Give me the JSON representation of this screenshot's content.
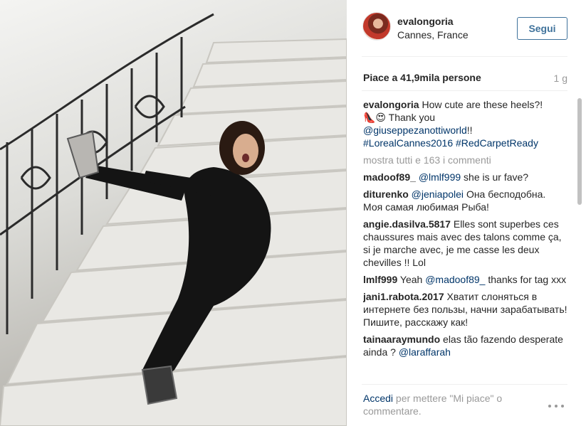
{
  "post": {
    "username": "evalongoria",
    "location": "Cannes, France",
    "follow_label": "Segui",
    "likes_text": "Piace a 41,9mila persone",
    "time_ago": "1 g",
    "caption": {
      "username": "evalongoria",
      "text_1": "How cute are these heels?!",
      "emoji": "👠😍",
      "text_2": "Thank you",
      "mention": "@giuseppezanottiworld",
      "text_3": "!!",
      "hashtags": "#LorealCannes2016 #RedCarpetReady"
    },
    "view_all_comments": "mostra tutti e 163 i commenti",
    "comments": [
      {
        "username": "madoof89_",
        "mention": "@lmlf999",
        "text": "she is ur fave?"
      },
      {
        "username": "diturenko",
        "mention": "@jeniapolei",
        "text": "Она бесподобна. Моя самая любимая Рыба!"
      },
      {
        "username": "angie.dasilva.5817",
        "mention": "",
        "text": "Elles sont superbes ces chaussures mais avec des talons comme ça, si je marche avec, je me casse les deux chevilles !! Lol"
      },
      {
        "username": "lmlf999",
        "mention": "",
        "text": "Yeah",
        "mention_after": "@madoof89_",
        "text_after": "thanks for tag xxx"
      },
      {
        "username": "jani1.rabota.2017",
        "mention": "",
        "text": "Хватит слоняться в интернете без пользы, начни зарабатывать! Пишите, расскажу как!"
      },
      {
        "username": "tainaaraymundo",
        "mention": "",
        "text": "elas tão fazendo desperate ainda ?",
        "mention_after": "@laraffarah",
        "text_after": ""
      }
    ],
    "footer": {
      "login_label": "Accedi",
      "rest": "per mettere \"Mi piace\" o commentare."
    }
  },
  "icons": {
    "more": "more-options-icon"
  },
  "colors": {
    "link": "#003569",
    "follow": "#3f729b",
    "muted": "#999999"
  }
}
